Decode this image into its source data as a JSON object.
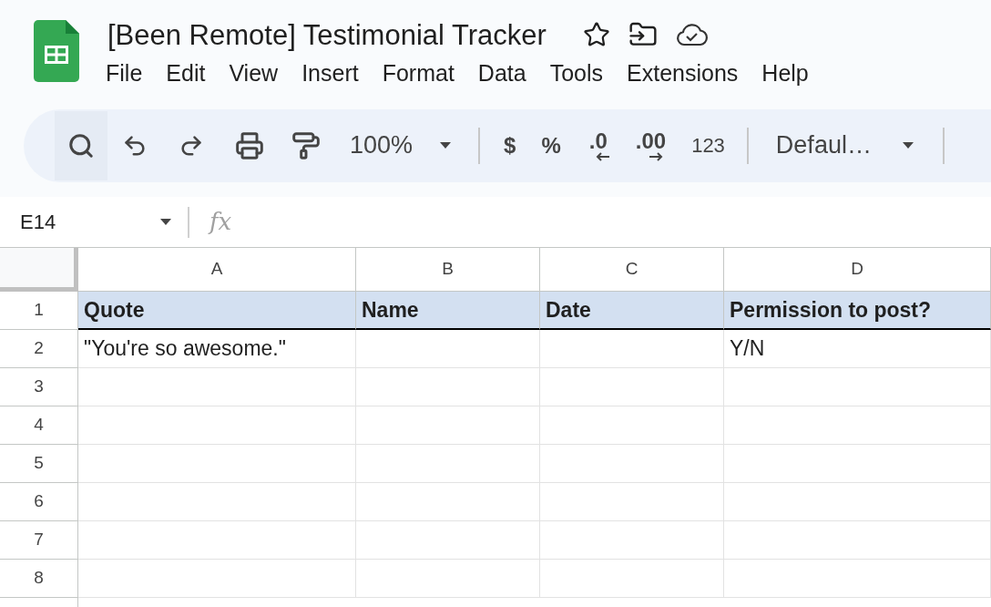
{
  "document": {
    "title": "[Been Remote] Testimonial Tracker"
  },
  "menu": [
    "File",
    "Edit",
    "View",
    "Insert",
    "Format",
    "Data",
    "Tools",
    "Extensions",
    "Help"
  ],
  "toolbar": {
    "zoom": "100%",
    "formats": [
      {
        "kind": "plain",
        "label": "$"
      },
      {
        "kind": "plain",
        "label": "%"
      },
      {
        "kind": "decrease",
        "label": ".0"
      },
      {
        "kind": "increase",
        "label": ".00"
      },
      {
        "kind": "plain",
        "label": "123"
      }
    ],
    "font": "Defaul…"
  },
  "formula_bar": {
    "name_box": "E14",
    "function_label": "fx"
  },
  "grid": {
    "columns": [
      "A",
      "B",
      "C",
      "D"
    ],
    "rows": [
      {
        "number": "1",
        "kind": "header",
        "cells": [
          "Quote",
          "Name",
          "Date",
          "Permission to post?"
        ]
      },
      {
        "number": "2",
        "kind": "data",
        "cells": [
          "\"You're so awesome.\"",
          "",
          "",
          "Y/N"
        ]
      },
      {
        "number": "3",
        "kind": "data",
        "cells": [
          "",
          "",
          "",
          ""
        ]
      },
      {
        "number": "4",
        "kind": "data",
        "cells": [
          "",
          "",
          "",
          ""
        ]
      },
      {
        "number": "5",
        "kind": "data",
        "cells": [
          "",
          "",
          "",
          ""
        ]
      },
      {
        "number": "6",
        "kind": "data",
        "cells": [
          "",
          "",
          "",
          ""
        ]
      },
      {
        "number": "7",
        "kind": "data",
        "cells": [
          "",
          "",
          "",
          ""
        ]
      },
      {
        "number": "8",
        "kind": "data",
        "cells": [
          "",
          "",
          "",
          ""
        ]
      }
    ]
  }
}
